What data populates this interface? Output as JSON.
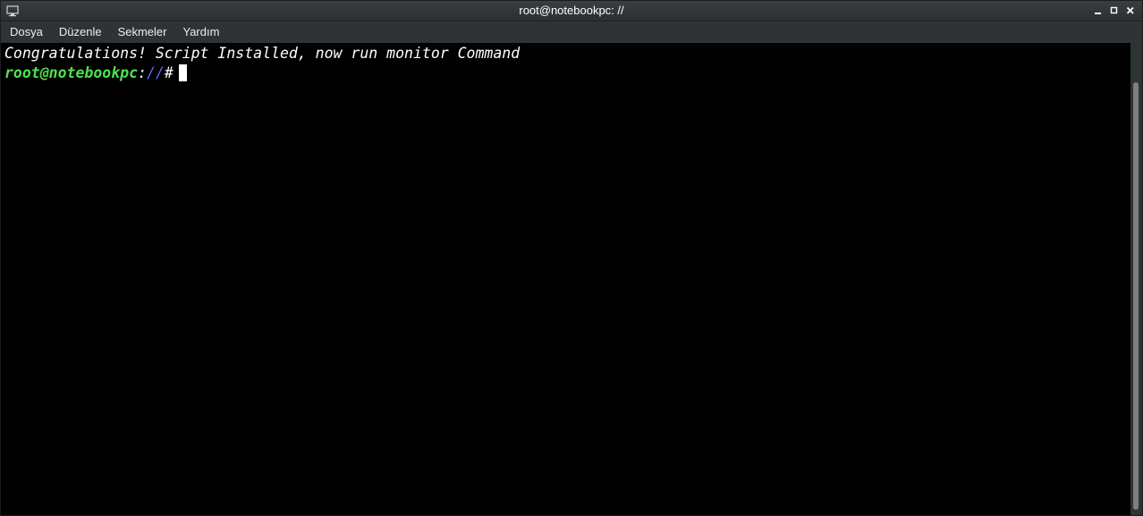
{
  "window": {
    "title": "root@notebookpc: //"
  },
  "titlebar_icons": {
    "app": "terminal-icon",
    "minimize": "minimize-icon",
    "maximize": "maximize-icon",
    "close": "close-icon"
  },
  "menubar": {
    "items": [
      "Dosya",
      "Düzenle",
      "Sekmeler",
      "Yardım"
    ]
  },
  "terminal": {
    "output_line": "Congratulations! Script Installed, now run monitor Command",
    "prompt": {
      "user_host": "root@notebookpc",
      "separator": ":",
      "path": "//",
      "symbol": "#"
    }
  },
  "colors": {
    "background": "#000000",
    "prompt_user": "#4ee04e",
    "prompt_path": "#5b6cf0",
    "text": "#ffffff"
  }
}
